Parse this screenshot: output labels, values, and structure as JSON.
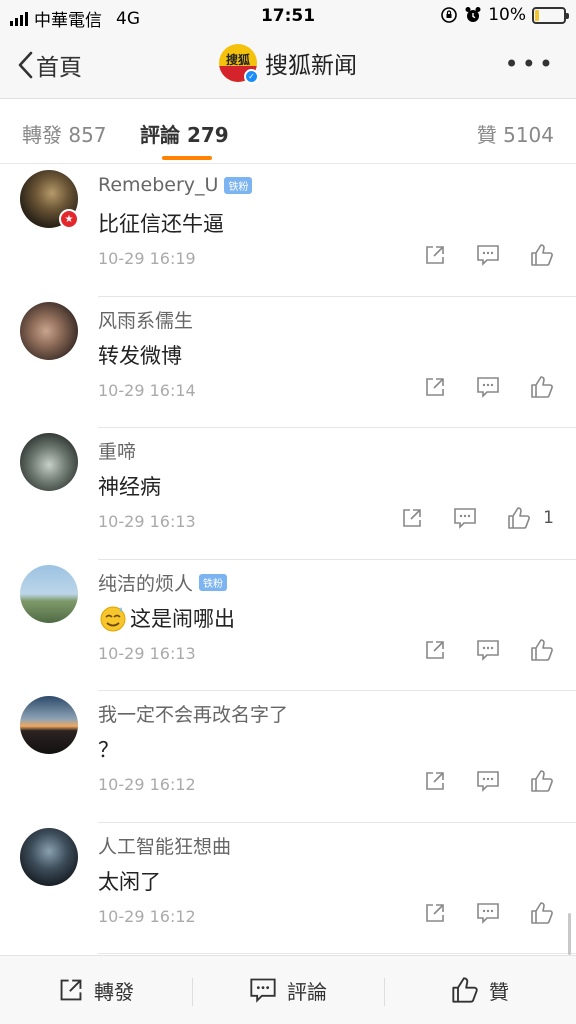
{
  "status_bar": {
    "carrier": "中華電信",
    "network": "4G",
    "time": "17:51",
    "battery": "10%",
    "battery_level": 0.1
  },
  "nav": {
    "back_label": "首頁",
    "title": "搜狐新闻",
    "logo_text": "搜狐",
    "more": "•••"
  },
  "tabs": {
    "repost": "轉發 857",
    "comment": "評論 279",
    "like": "贊 5104"
  },
  "colors": {
    "accent": "#ff8200",
    "fan_badge": "#7cb4f2",
    "verify": "#1a8dfb"
  },
  "comments": [
    {
      "name": "Remebery_U",
      "fan": "铁粉",
      "text": "比征信还牛逼",
      "time": "10-29 16:19",
      "likes": ""
    },
    {
      "name": "风雨系儒生",
      "fan": "",
      "text": "转发微博",
      "time": "10-29 16:14",
      "likes": ""
    },
    {
      "name": "重啼",
      "fan": "",
      "text": "神经病",
      "time": "10-29 16:13",
      "likes": "1"
    },
    {
      "name": "纯洁的烦人",
      "fan": "铁粉",
      "text": "这是闹哪出",
      "time": "10-29 16:13",
      "likes": ""
    },
    {
      "name": "我一定不会再改名字了",
      "fan": "",
      "text": "？",
      "time": "10-29 16:12",
      "likes": ""
    },
    {
      "name": "人工智能狂想曲",
      "fan": "",
      "text": "太闲了",
      "time": "10-29 16:12",
      "likes": ""
    }
  ],
  "bottom_bar": {
    "repost": "轉發",
    "comment": "評論",
    "like": "贊"
  }
}
